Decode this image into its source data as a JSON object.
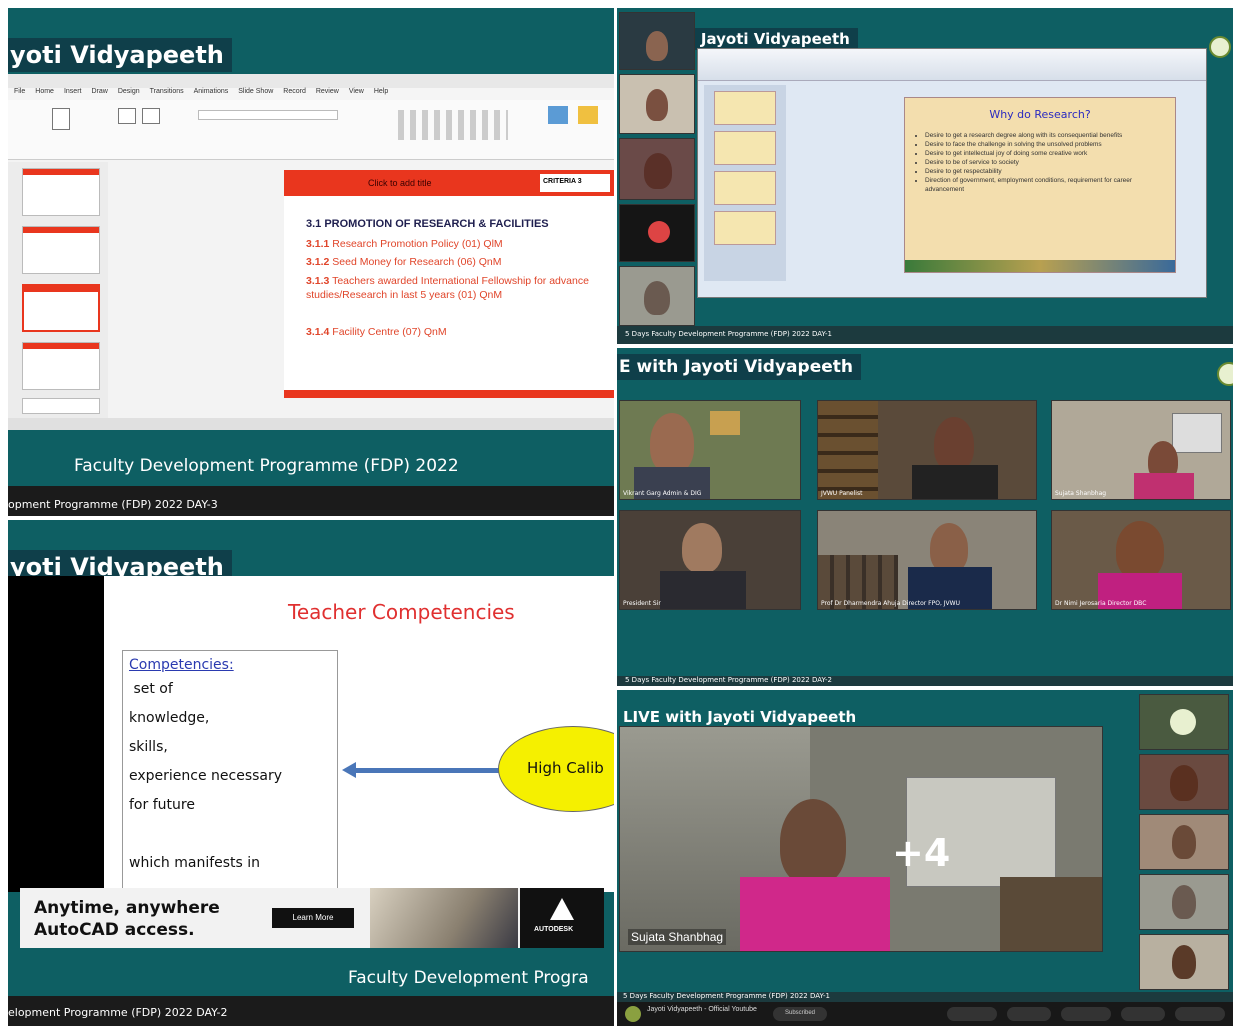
{
  "panel_a": {
    "banner": "yoti Vidyapeeth",
    "ppt_menu": [
      "File",
      "Home",
      "Insert",
      "Draw",
      "Design",
      "Transitions",
      "Animations",
      "Slide Show",
      "Record",
      "Review",
      "View",
      "Help"
    ],
    "slide_header": "Click to add title",
    "slide_logo": "CRITERIA 3",
    "slide_heading": "3.1  PROMOTION OF RESEARCH & FACILITIES",
    "slide_items": [
      {
        "num": "3.1.1",
        "text": "Research Promotion Policy (01) QlM"
      },
      {
        "num": "3.1.2",
        "text": "Seed Money for Research (06) QnM"
      },
      {
        "num": "3.1.3",
        "text": "Teachers awarded International Fellowship for advance studies/Research in last 5 years (01) QnM"
      },
      {
        "num": "3.1.4",
        "text": "Facility Centre (07) QnM"
      }
    ],
    "caption": "Faculty Development Programme (FDP) 2022",
    "footer": "opment Programme (FDP) 2022 DAY-3"
  },
  "panel_b": {
    "banner": "n Jayoti Vidyapeeth",
    "slide_title": "Why do Research?",
    "bullets": [
      "Desire to get a research degree along with its consequential benefits",
      "Desire to face the challenge in solving the unsolved problems",
      "Desire to get intellectual joy of doing some creative work",
      "Desire to be of service to society",
      "Desire to get respectability",
      "Direction of government, employment conditions, requirement for career advancement"
    ],
    "footer": "5 Days Faculty Development Programme (FDP) 2022 DAY-1"
  },
  "panel_c": {
    "banner": "E with Jayoti Vidyapeeth",
    "tiles": [
      {
        "name": "Vikrant Garg Admin & DIG"
      },
      {
        "name": "JVWU Panelist"
      },
      {
        "name": "Sujata Shanbhag"
      },
      {
        "name": "President Sir"
      },
      {
        "name": "Prof Dr Dharmendra Ahuja Director FPO, JVWU"
      },
      {
        "name": "Dr Nimi Jerosaria Director DBC"
      }
    ],
    "footer": "5 Days Faculty Development Programme (FDP) 2022 DAY-2"
  },
  "panel_d": {
    "banner": "yoti Vidyapeeth",
    "slide_title": "Teacher Competencies",
    "box_heading": "Competencies:",
    "box_lines": [
      " set of",
      "knowledge,",
      "skills,",
      "experience necessary",
      "for future",
      "",
      "which manifests in"
    ],
    "bubble": "High Calib",
    "ad_line1": "Anytime, anywhere",
    "ad_line2": "AutoCAD access.",
    "ad_button": "Learn More",
    "ad_brand": "AUTODESK",
    "caption": "Faculty Development Progra",
    "footer": "elopment Programme (FDP) 2022 DAY-2"
  },
  "panel_e": {
    "banner": "LIVE with Jayoti Vidyapeeth",
    "speaker_name": "Sujata Shanbhag",
    "more_count": "+4",
    "footer": "5 Days Faculty Development Programme (FDP) 2022 DAY-1",
    "channel": "Jayoti Vidyapeeth - Official Youtube",
    "subscribe": "Subscribed"
  },
  "colors": {
    "teal": "#0e5f63",
    "dark_banner": "#0f3f4a",
    "slide_red": "#e9361e",
    "bubble_yellow": "#f5f000"
  }
}
